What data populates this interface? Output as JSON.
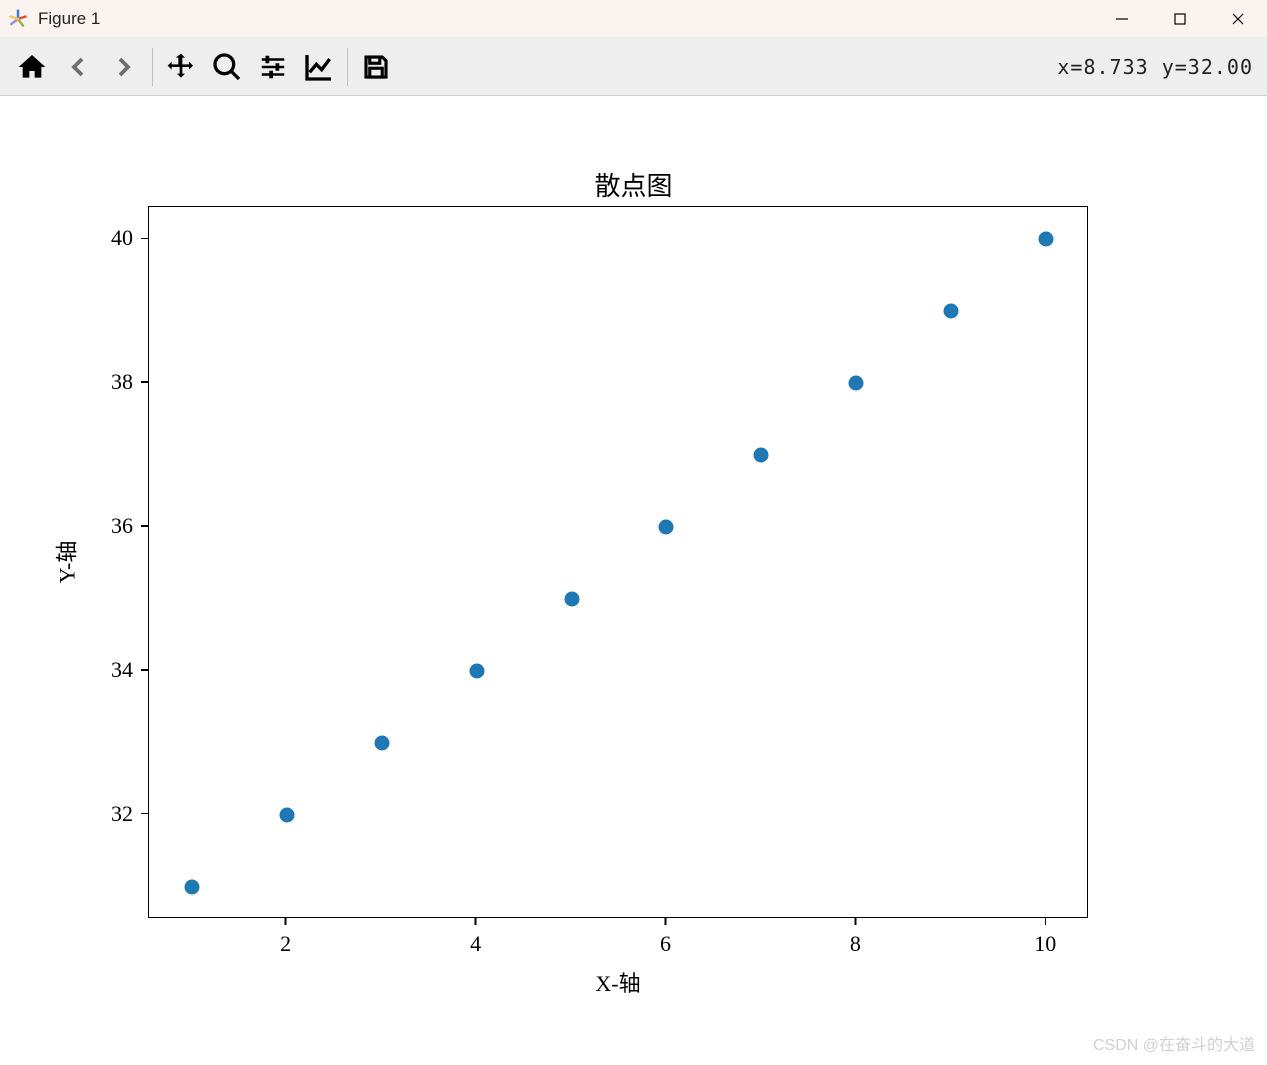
{
  "window": {
    "title": "Figure 1"
  },
  "toolbar": {
    "coords": "x=8.733  y=32.00"
  },
  "chart_data": {
    "type": "scatter",
    "title": "散点图",
    "xlabel": "X-轴",
    "ylabel": "Y-轴",
    "x": [
      1,
      2,
      3,
      4,
      5,
      6,
      7,
      8,
      9,
      10
    ],
    "y": [
      31,
      32,
      33,
      34,
      35,
      36,
      37,
      38,
      39,
      40
    ],
    "xlim": [
      0.55,
      10.45
    ],
    "ylim": [
      30.55,
      40.45
    ],
    "xticks": [
      2,
      4,
      6,
      8,
      10
    ],
    "yticks": [
      32,
      34,
      36,
      38,
      40
    ],
    "point_color": "#1f77b4"
  },
  "watermark": "CSDN @在奋斗的大道"
}
